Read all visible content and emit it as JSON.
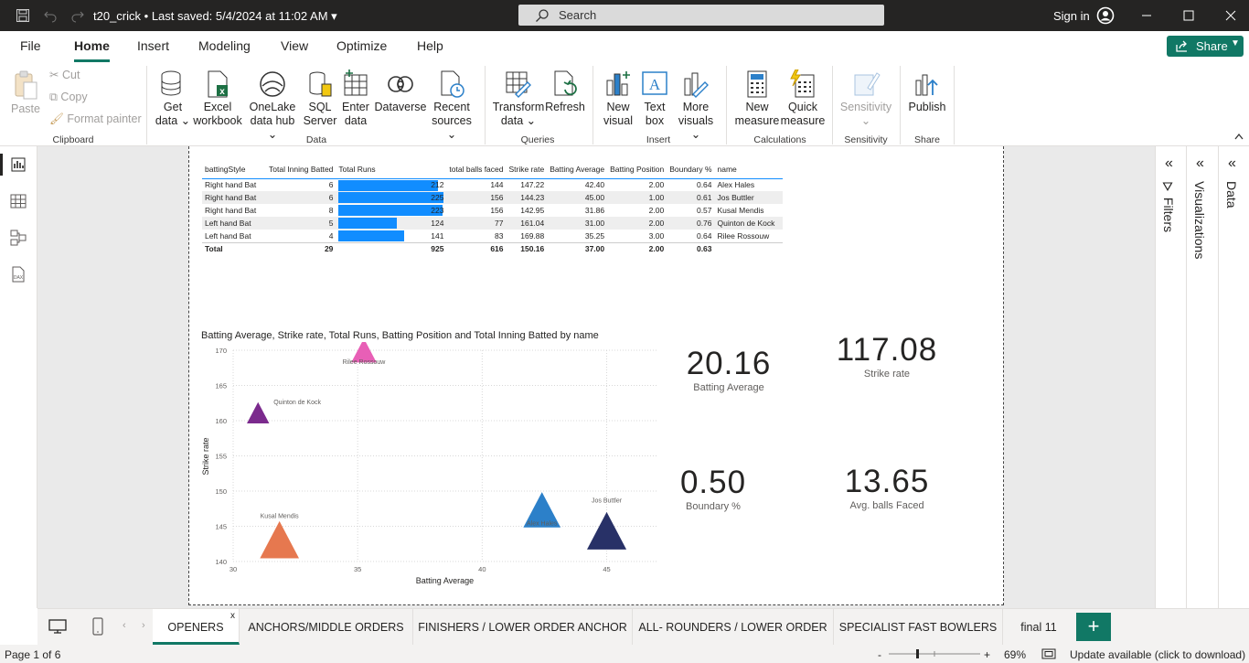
{
  "titlebar": {
    "file_name": "t20_crick",
    "saved": "Last saved: 5/4/2024 at 11:02 AM",
    "search_placeholder": "Search",
    "signin": "Sign in"
  },
  "menu": {
    "items": [
      "File",
      "Home",
      "Insert",
      "Modeling",
      "View",
      "Optimize",
      "Help"
    ],
    "active": "Home",
    "share": "Share"
  },
  "ribbon": {
    "clipboard": {
      "paste": "Paste",
      "cut": "Cut",
      "copy": "Copy",
      "format_painter": "Format painter",
      "label": "Clipboard"
    },
    "data": {
      "get_data": [
        "Get",
        "data"
      ],
      "excel": [
        "Excel",
        "workbook"
      ],
      "onelake": [
        "OneLake",
        "data hub"
      ],
      "sql": [
        "SQL",
        "Server"
      ],
      "enter": [
        "Enter",
        "data"
      ],
      "dataverse": "Dataverse",
      "recent": [
        "Recent",
        "sources"
      ],
      "label": "Data"
    },
    "queries": {
      "transform": [
        "Transform",
        "data"
      ],
      "refresh": "Refresh",
      "label": "Queries"
    },
    "insert": {
      "new_visual": [
        "New",
        "visual"
      ],
      "text_box": [
        "Text",
        "box"
      ],
      "more_visuals": [
        "More",
        "visuals"
      ],
      "label": "Insert"
    },
    "calculations": {
      "new_measure": [
        "New",
        "measure"
      ],
      "quick_measure": [
        "Quick",
        "measure"
      ],
      "label": "Calculations"
    },
    "sensitivity": {
      "button": "Sensitivity",
      "label": "Sensitivity"
    },
    "share": {
      "publish": "Publish",
      "label": "Share"
    }
  },
  "panes": {
    "filters": "Filters",
    "visualizations": "Visualizations",
    "data": "Data"
  },
  "table": {
    "headers": [
      "battingStyle",
      "Total Inning Batted",
      "Total Runs",
      "total balls faced",
      "Strike rate",
      "Batting Average",
      "Batting Position",
      "Boundary %",
      "name"
    ],
    "rows": [
      [
        "Right hand Bat",
        "6",
        "212",
        "144",
        "147.22",
        "42.40",
        "2.00",
        "0.64",
        "Alex Hales"
      ],
      [
        "Right hand Bat",
        "6",
        "225",
        "156",
        "144.23",
        "45.00",
        "1.00",
        "0.61",
        "Jos Buttler"
      ],
      [
        "Right hand Bat",
        "8",
        "223",
        "156",
        "142.95",
        "31.86",
        "2.00",
        "0.57",
        "Kusal Mendis"
      ],
      [
        "Left hand Bat",
        "5",
        "124",
        "77",
        "161.04",
        "31.00",
        "2.00",
        "0.76",
        "Quinton de Kock"
      ],
      [
        "Left hand Bat",
        "4",
        "141",
        "83",
        "169.88",
        "35.25",
        "3.00",
        "0.64",
        "Rilee Rossouw"
      ]
    ],
    "runs_values": [
      212,
      225,
      223,
      124,
      141
    ],
    "total": [
      "Total",
      "29",
      "925",
      "616",
      "150.16",
      "37.00",
      "2.00",
      "0.63",
      ""
    ],
    "bar_color": "#118dff"
  },
  "chart_data": {
    "type": "scatter",
    "title": "Batting Average, Strike rate, Total Runs, Batting Position and Total Inning Batted by name",
    "xlabel": "Batting Average",
    "ylabel": "Strike rate",
    "xlim": [
      30,
      47
    ],
    "ylim": [
      140,
      170
    ],
    "xticks": [
      30,
      35,
      40,
      45
    ],
    "yticks": [
      140,
      145,
      150,
      155,
      160,
      165,
      170
    ],
    "grid": true,
    "points": [
      {
        "name": "Alex Hales",
        "x": 42.4,
        "y": 147.22,
        "size": 212,
        "color": "#2c80c9",
        "shape": "triangle"
      },
      {
        "name": "Jos Buttler",
        "x": 45.0,
        "y": 144.23,
        "size": 225,
        "color": "#283167",
        "shape": "triangle"
      },
      {
        "name": "Kusal Mendis",
        "x": 31.86,
        "y": 142.95,
        "size": 223,
        "color": "#e6784f",
        "shape": "triangle"
      },
      {
        "name": "Quinton de Kock",
        "x": 31.0,
        "y": 161.04,
        "size": 124,
        "color": "#7b2a8d",
        "shape": "triangle"
      },
      {
        "name": "Rilee Rossouw",
        "x": 35.25,
        "y": 169.88,
        "size": 141,
        "color": "#e85fb6",
        "shape": "triangle"
      }
    ]
  },
  "kpis": [
    {
      "value": "20.16",
      "label": "Batting Average"
    },
    {
      "value": "117.08",
      "label": "Strike rate"
    },
    {
      "value": "0.50",
      "label": "Boundary %"
    },
    {
      "value": "13.65",
      "label": "Avg. balls Faced"
    }
  ],
  "tabs": [
    "OPENERS",
    "ANCHORS/MIDDLE ORDERS",
    "FINISHERS / LOWER ORDER ANCHOR",
    "ALL- ROUNDERS / LOWER ORDER",
    "SPECIALIST FAST BOWLERS",
    "final 11"
  ],
  "active_tab": "OPENERS",
  "status": {
    "page": "Page 1 of 6",
    "zoom": "69%",
    "update": "Update available (click to download)"
  }
}
